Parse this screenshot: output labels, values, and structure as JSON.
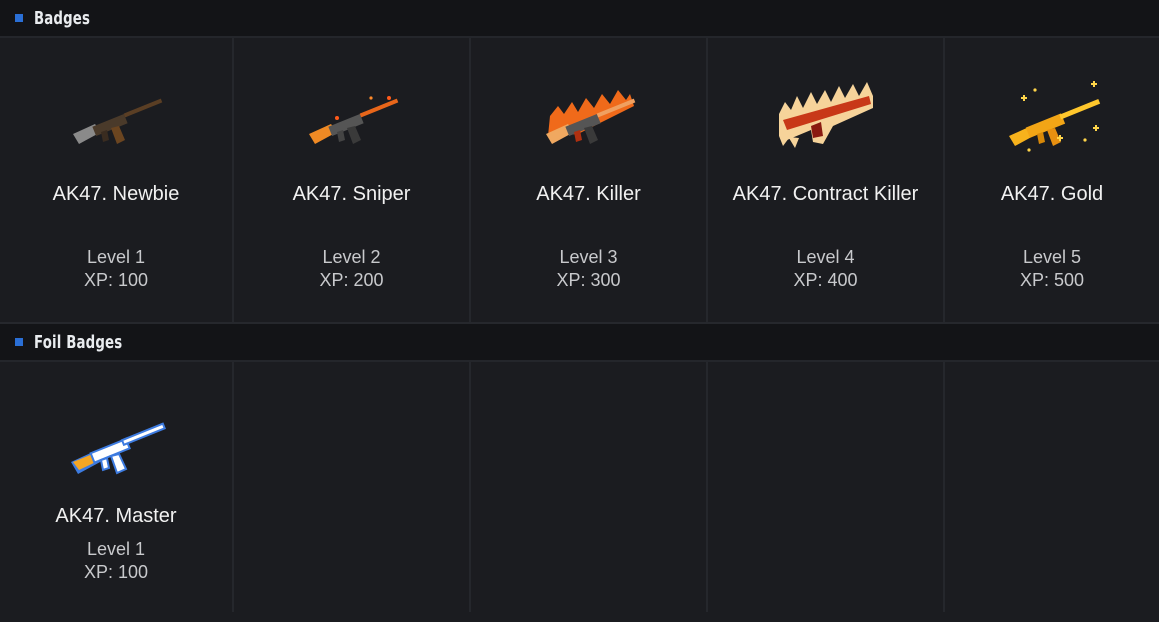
{
  "sections": {
    "badges": {
      "title": "Badges",
      "items": [
        {
          "name": "AK47. Newbie",
          "level": "Level 1",
          "xp": "XP: 100",
          "icon": "ak47-newbie-icon"
        },
        {
          "name": "AK47. Sniper",
          "level": "Level 2",
          "xp": "XP: 200",
          "icon": "ak47-sniper-icon"
        },
        {
          "name": "AK47. Killer",
          "level": "Level 3",
          "xp": "XP: 300",
          "icon": "ak47-killer-icon"
        },
        {
          "name": "AK47. Contract Killer",
          "level": "Level 4",
          "xp": "XP: 400",
          "icon": "ak47-contract-killer-icon"
        },
        {
          "name": "AK47. Gold",
          "level": "Level 5",
          "xp": "XP: 500",
          "icon": "ak47-gold-icon"
        }
      ]
    },
    "foil": {
      "title": "Foil Badges",
      "items": [
        {
          "name": "AK47. Master",
          "level": "Level 1",
          "xp": "XP: 100",
          "icon": "ak47-master-icon"
        }
      ]
    }
  },
  "colors": {
    "background": "#1b1c20",
    "header_background": "#131417",
    "marker_blue": "#2a6fd6",
    "text": "#f1f1f1",
    "muted_text": "#c8c9cc"
  }
}
